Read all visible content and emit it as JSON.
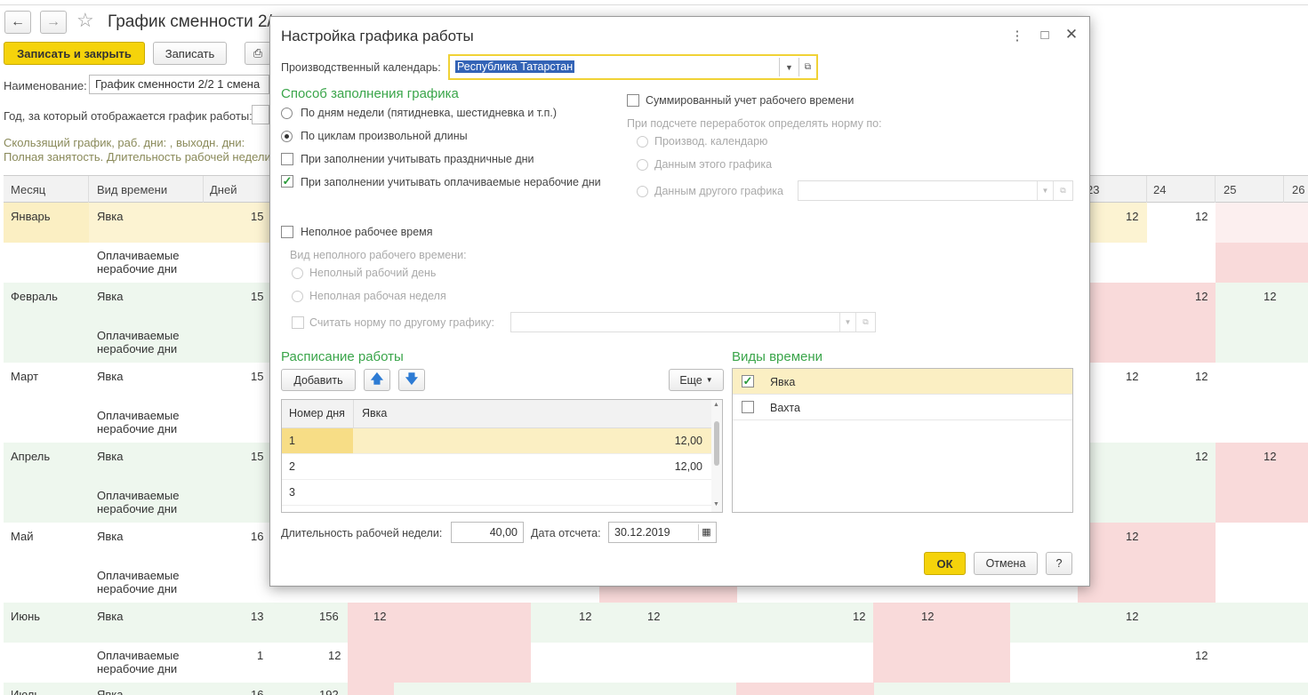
{
  "background": {
    "nav_back": "←",
    "nav_forward": "→",
    "title": "График сменности 2/",
    "save_close": "Записать и закрыть",
    "save": "Записать",
    "name_label": "Наименование:",
    "name_value": "График сменности 2/2 1 смена",
    "year_label": "Год, за который отображается график работы:",
    "info1": "Скользящий график, раб. дни: , выходн. дни:",
    "info2": "Полная занятость. Длительность рабочей недели:",
    "columns": {
      "month": "Месяц",
      "kind": "Вид времени",
      "days": "Дней",
      "d23": "23",
      "d24": "24",
      "d25": "25",
      "d26": "26"
    },
    "months": [
      {
        "name": "Январь",
        "kind1": "Явка",
        "days1": "15",
        "kind2": "Оплачиваемые нерабочие дни"
      },
      {
        "name": "Февраль",
        "kind1": "Явка",
        "days1": "15",
        "kind2": "Оплачиваемые нерабочие дни"
      },
      {
        "name": "Март",
        "kind1": "Явка",
        "days1": "15",
        "kind2": "Оплачиваемые нерабочие дни"
      },
      {
        "name": "Апрель",
        "kind1": "Явка",
        "days1": "15",
        "kind2": "Оплачиваемые нерабочие дни"
      },
      {
        "name": "Май",
        "kind1": "Явка",
        "days1": "16",
        "kind2": "Оплачиваемые нерабочие дни"
      },
      {
        "name": "Июнь",
        "kind1": "Явка",
        "days1": "13",
        "hours1": "156",
        "kind2": "Оплачиваемые нерабочие дни",
        "days2": "1",
        "hours2": "12"
      },
      {
        "name": "Июль",
        "kind1": "Явка",
        "days1": "16",
        "hours1": "192"
      }
    ],
    "hours12": "12"
  },
  "dialog": {
    "title": "Настройка графика работы",
    "calendar_label": "Производственный календарь:",
    "calendar_value": "Республика Татарстан",
    "fill_section": "Способ заполнения графика",
    "radio_weekdays": "По дням недели (пятидневка, шестидневка и т.п.)",
    "radio_cycles": "По циклам произвольной длины",
    "chk_holidays": "При заполнении учитывать праздничные дни",
    "chk_paid": "При заполнении учитывать оплачиваемые нерабочие дни",
    "chk_summary": "Суммированный учет рабочего времени",
    "overtime_label": "При подсчете переработок определять норму по:",
    "r_prod_cal": "Производ. календарю",
    "r_this_sched": "Данным этого графика",
    "r_other_sched": "Данным другого графика",
    "chk_part_time": "Неполное рабочее время",
    "part_kind_label": "Вид неполного рабочего времени:",
    "r_part_day": "Неполный рабочий день",
    "r_part_week": "Неполная рабочая неделя",
    "chk_norm_other": "Считать норму по другому графику:",
    "schedule_section": "Расписание работы",
    "add_button": "Добавить",
    "more_button": "Еще",
    "grid_col_day": "Номер дня",
    "grid_col_attend": "Явка",
    "grid_rows": [
      {
        "day": "1",
        "value": "12,00"
      },
      {
        "day": "2",
        "value": "12,00"
      },
      {
        "day": "3",
        "value": ""
      }
    ],
    "time_kinds_section": "Виды времени",
    "time_kinds": [
      {
        "label": "Явка",
        "checked": true
      },
      {
        "label": "Вахта",
        "checked": false
      }
    ],
    "week_len_label": "Длительность рабочей недели:",
    "week_len_value": "40,00",
    "ref_date_label": "Дата отсчета:",
    "ref_date_value": "30.12.2019",
    "ok": "ОК",
    "cancel": "Отмена",
    "help": "?"
  }
}
